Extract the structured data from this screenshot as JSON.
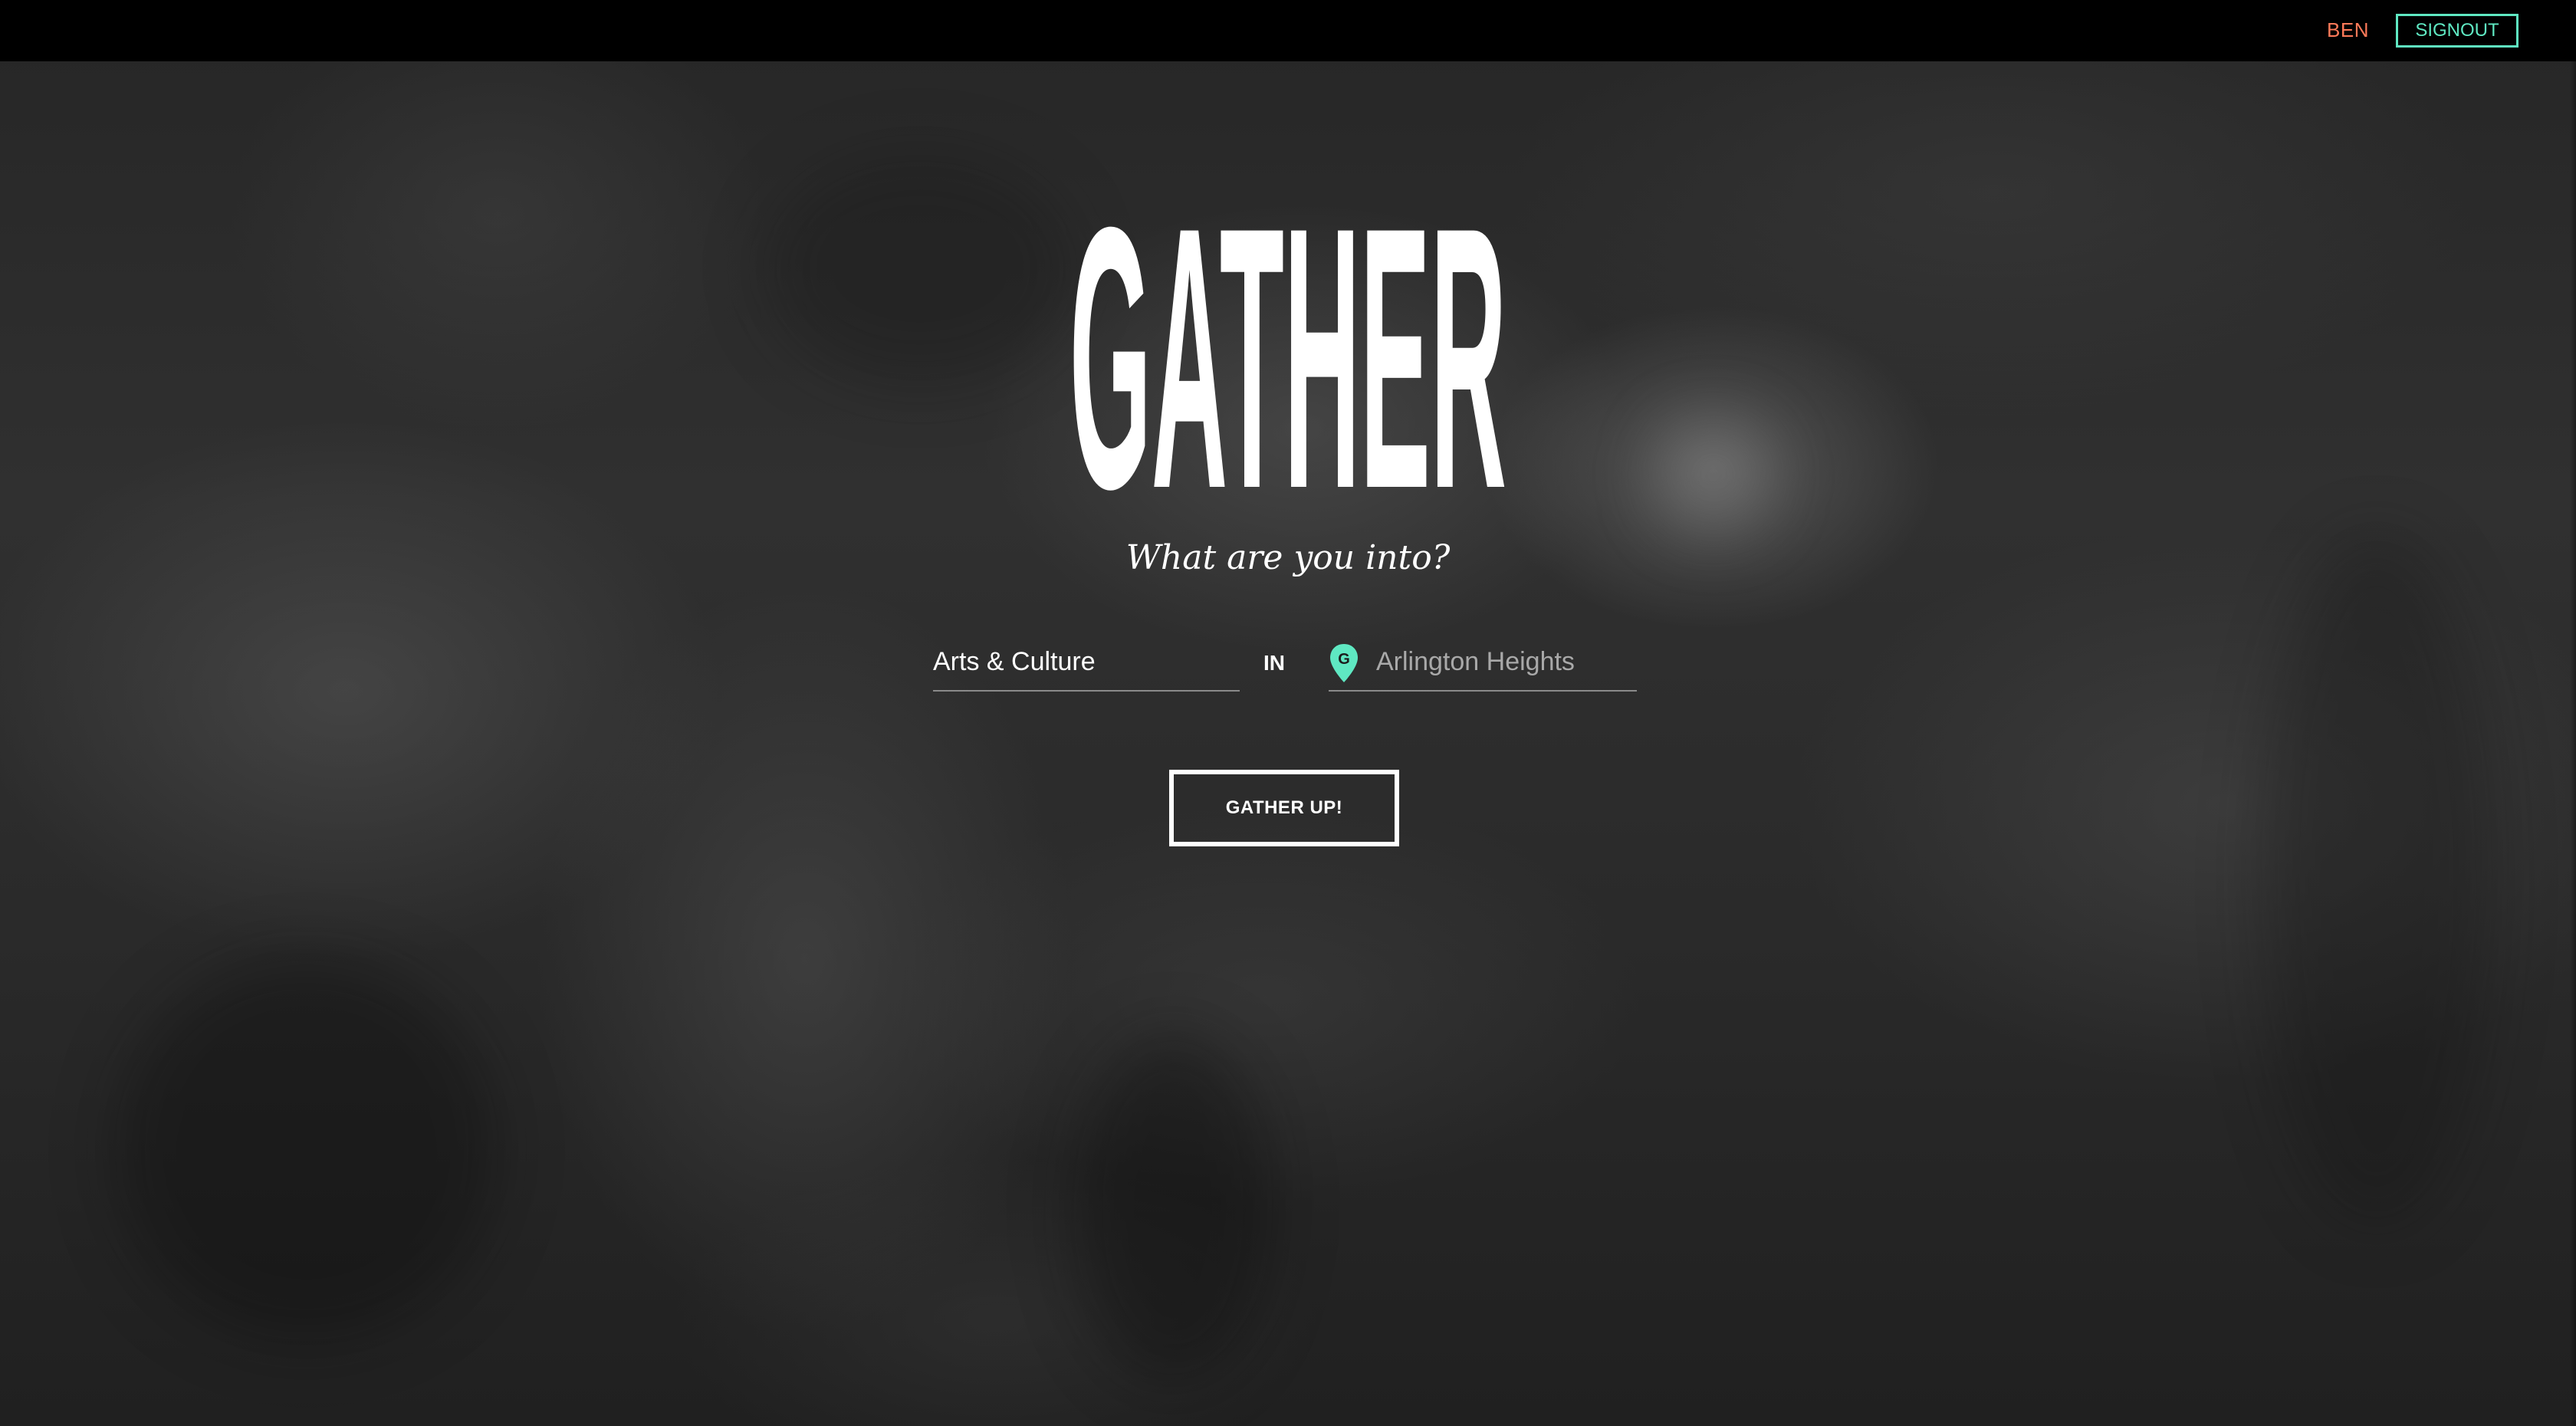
{
  "header": {
    "user_label": "BEN",
    "signout_label": "SIGNOUT"
  },
  "hero": {
    "logo_text": "GATHER",
    "tagline": "What are you into?"
  },
  "search": {
    "interest_value": "Arts & Culture",
    "connector_label": "IN",
    "location_placeholder": "Arlington Heights",
    "location_icon_letter": "G",
    "submit_label": "GATHER UP!"
  },
  "colors": {
    "accent_orange": "#ff7a59",
    "accent_mint": "#5fe8c2",
    "topbar": "#000000",
    "text": "#ffffff"
  },
  "icons": {
    "location": "map-pin-icon"
  }
}
